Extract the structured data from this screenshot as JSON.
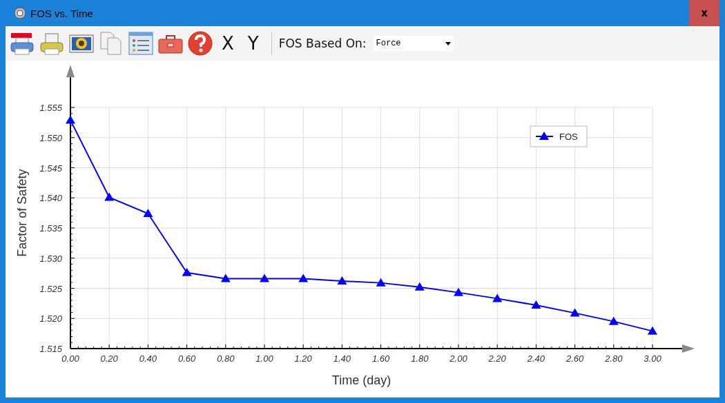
{
  "window": {
    "title": "FOS vs. Time",
    "close_label": "x"
  },
  "toolbar": {
    "icon_buttons": [
      {
        "kind": "print-preview"
      },
      {
        "kind": "printer"
      },
      {
        "kind": "image"
      },
      {
        "kind": "copy"
      },
      {
        "kind": "list"
      },
      {
        "kind": "toolbox"
      },
      {
        "kind": "help"
      }
    ],
    "axis_buttons": [
      "X",
      "Y"
    ],
    "fos_based_on": {
      "label": "FOS Based On:",
      "value": "Force"
    }
  },
  "chart": {
    "chart_data": {
      "type": "line",
      "xlabel": "Time (day)",
      "ylabel": "Factor of Safety",
      "x": [
        0,
        0.2,
        0.4,
        0.6,
        0.8,
        1.0,
        1.2,
        1.4,
        1.6,
        1.8,
        2.0,
        2.2,
        2.4,
        2.6,
        2.8,
        3.0
      ],
      "series": [
        {
          "name": "FOS",
          "color": "#0000ff",
          "marker": "triangle",
          "values": [
            1.5529,
            1.5401,
            1.5374,
            1.5276,
            1.5266,
            1.5266,
            1.5266,
            1.5262,
            1.5259,
            1.5252,
            1.5243,
            1.5233,
            1.5222,
            1.5209,
            1.5195,
            1.5179
          ]
        }
      ],
      "xlim": [
        0,
        3
      ],
      "ylim": [
        1.515,
        1.56
      ],
      "grid": true,
      "xticks": [
        {
          "value": 0,
          "label": "0.00"
        },
        {
          "value": 0.2,
          "label": "0.20"
        },
        {
          "value": 0.4,
          "label": "0.40"
        },
        {
          "value": 0.6,
          "label": "0.60"
        },
        {
          "value": 0.8,
          "label": "0.80"
        },
        {
          "value": 1.0,
          "label": "1.00"
        },
        {
          "value": 1.2,
          "label": "1.20"
        },
        {
          "value": 1.4,
          "label": "1.40"
        },
        {
          "value": 1.6,
          "label": "1.60"
        },
        {
          "value": 1.8,
          "label": "1.80"
        },
        {
          "value": 2.0,
          "label": "2.00"
        },
        {
          "value": 2.2,
          "label": "2.20"
        },
        {
          "value": 2.4,
          "label": "2.40"
        },
        {
          "value": 2.6,
          "label": "2.60"
        },
        {
          "value": 2.8,
          "label": "2.80"
        },
        {
          "value": 3.0,
          "label": "3.00"
        }
      ],
      "yticks": [
        {
          "value": 1.515,
          "label": "1.515"
        },
        {
          "value": 1.52,
          "label": "1.520"
        },
        {
          "value": 1.525,
          "label": "1.525"
        },
        {
          "value": 1.53,
          "label": "1.530"
        },
        {
          "value": 1.535,
          "label": "1.535"
        },
        {
          "value": 1.54,
          "label": "1.540"
        },
        {
          "value": 1.545,
          "label": "1.545"
        },
        {
          "value": 1.55,
          "label": "1.550"
        },
        {
          "value": 1.555,
          "label": "1.555"
        }
      ]
    }
  }
}
